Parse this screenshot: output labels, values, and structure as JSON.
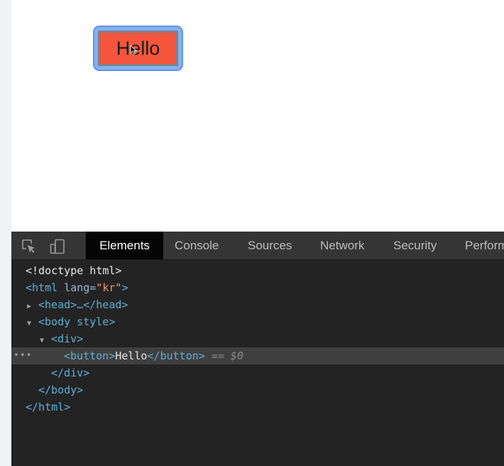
{
  "page": {
    "button_label": "Hello"
  },
  "devtools": {
    "tabs": [
      "Elements",
      "Console",
      "Sources",
      "Network",
      "Security",
      "Perform"
    ],
    "active_tab": "Elements",
    "icons": [
      "inspect-element-icon",
      "device-toolbar-icon"
    ],
    "dom": {
      "doctype": "<!doctype html>",
      "html_open_tag": "<html ",
      "html_attr": "lang=",
      "html_attr_value": "\"kr\"",
      "html_close_bracket": ">",
      "head_line": "<head>…</head>",
      "body_line": "<body style>",
      "div_open": "<div>",
      "button_open": "<button>",
      "button_text": "Hello",
      "button_close": "</button>",
      "selected_marker": " == $0",
      "row_menu": "•••",
      "div_close": "</div>",
      "body_close": "</body>",
      "html_close": "</html>"
    }
  },
  "colors": {
    "button_bg": "#f5553c",
    "focus_ring": "#5e94e6",
    "devtools_bg": "#232323",
    "tag_color": "#5db0d7",
    "attr_value_color": "#f29766"
  }
}
